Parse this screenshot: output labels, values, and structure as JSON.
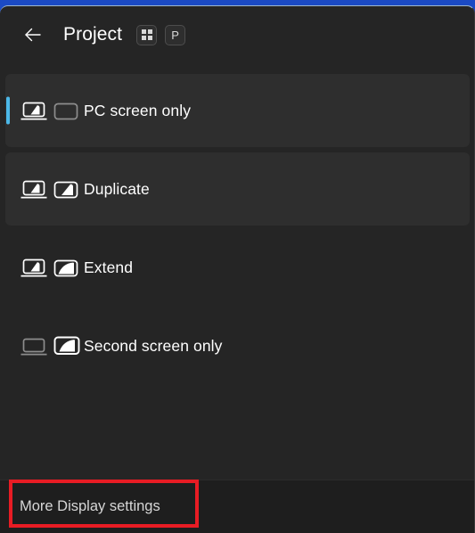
{
  "window": {
    "panel_name": "project-flyout",
    "background_color": "#252525",
    "accent_color": "#4cb8e8",
    "annotation_color": "#e81c24"
  },
  "header": {
    "back_icon": "arrow-left-icon",
    "title": "Project",
    "shortcut": {
      "key1_icon": "windows-logo-icon",
      "key1_label": "",
      "key2_label": "P"
    }
  },
  "modes": [
    {
      "label": "PC screen only",
      "selected": true,
      "tinted": true,
      "laptop_state": "active",
      "monitor_state": "inactive",
      "icon_name": "pc-screen-only-icon"
    },
    {
      "label": "Duplicate",
      "selected": false,
      "tinted": true,
      "laptop_state": "active",
      "monitor_state": "active",
      "icon_name": "duplicate-icon"
    },
    {
      "label": "Extend",
      "selected": false,
      "tinted": false,
      "laptop_state": "active",
      "monitor_state": "extend",
      "icon_name": "extend-icon"
    },
    {
      "label": "Second screen only",
      "selected": false,
      "tinted": false,
      "laptop_state": "inactive",
      "monitor_state": "active",
      "icon_name": "second-screen-only-icon"
    }
  ],
  "footer": {
    "link_label": "More Display settings"
  }
}
